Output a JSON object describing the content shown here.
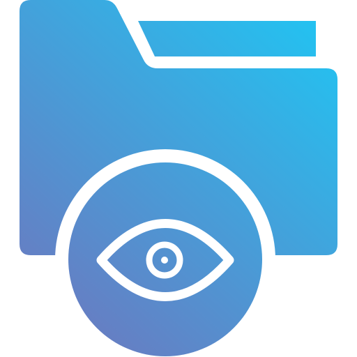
{
  "icon": {
    "name": "folder-view-icon",
    "parts": [
      "folder-icon",
      "eye-icon"
    ],
    "colors": {
      "gradient_start": "#6C78BF",
      "gradient_end": "#21C4F2",
      "foreground": "#FFFFFF",
      "background": "#FFFFFF"
    }
  }
}
